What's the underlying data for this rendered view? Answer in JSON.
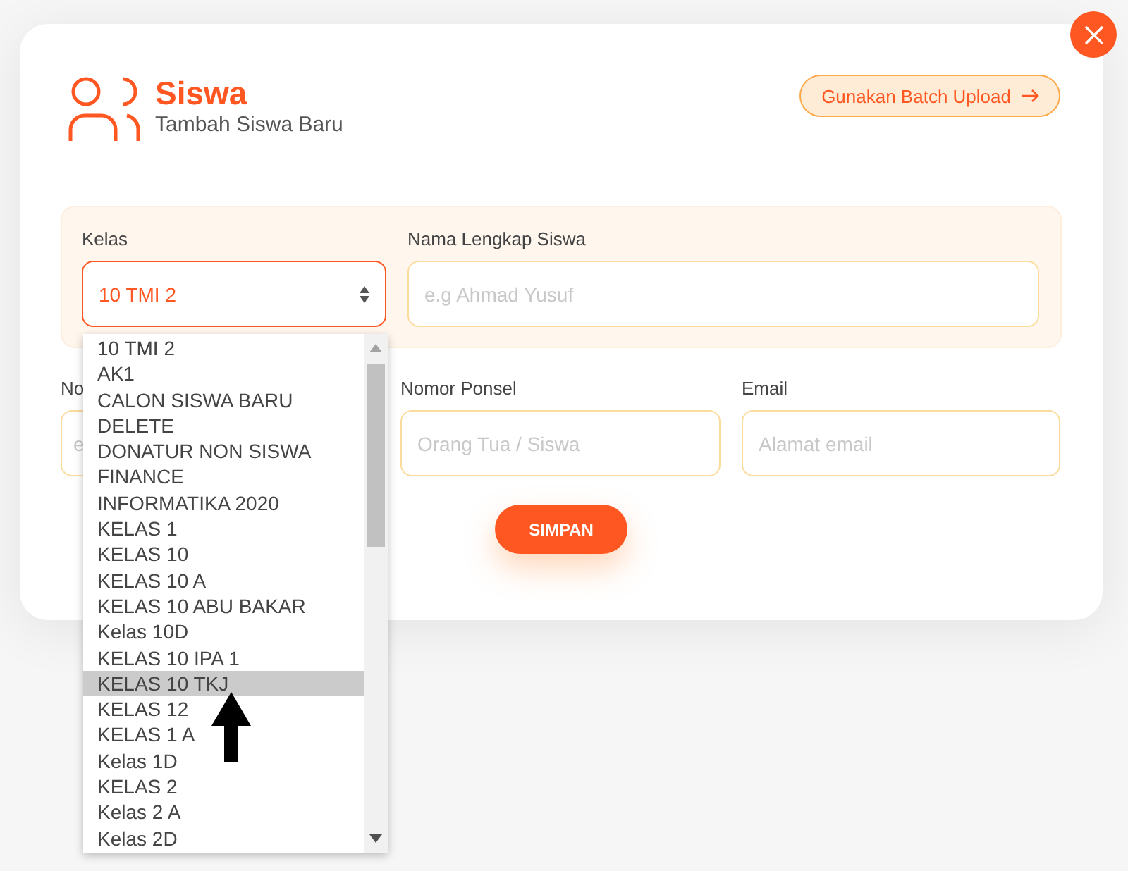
{
  "header": {
    "title": "Siswa",
    "subtitle": "Tambah Siswa Baru"
  },
  "batch_button": {
    "label": "Gunakan Batch Upload"
  },
  "form": {
    "panel_fields": [
      {
        "kind": "select",
        "label": "Kelas",
        "value": "10 TMI 2"
      },
      {
        "kind": "text",
        "label": "Nama Lengkap Siswa",
        "placeholder": "e.g Ahmad Yusuf"
      }
    ],
    "fields": [
      {
        "kind": "text",
        "label": "No",
        "placeholder": "e"
      },
      {
        "kind": "text",
        "label": "Nomor Ponsel",
        "placeholder": "Orang Tua / Siswa"
      },
      {
        "kind": "text",
        "label": "Email",
        "placeholder": "Alamat email"
      }
    ],
    "submit": "SIMPAN"
  },
  "dropdown": {
    "options": [
      {
        "label": "10 TMI 2",
        "selected": false
      },
      {
        "label": "AK1",
        "selected": false
      },
      {
        "label": "CALON SISWA BARU",
        "selected": false
      },
      {
        "label": "DELETE",
        "selected": false
      },
      {
        "label": "DONATUR NON SISWA",
        "selected": false
      },
      {
        "label": "FINANCE",
        "selected": false
      },
      {
        "label": "INFORMATIKA 2020",
        "selected": false
      },
      {
        "label": "KELAS 1",
        "selected": false
      },
      {
        "label": "KELAS 10",
        "selected": false
      },
      {
        "label": "KELAS 10 A",
        "selected": false
      },
      {
        "label": "KELAS 10 ABU BAKAR",
        "selected": false
      },
      {
        "label": "Kelas 10D",
        "selected": false
      },
      {
        "label": "KELAS 10 IPA 1",
        "selected": false
      },
      {
        "label": "KELAS 10 TKJ",
        "selected": true
      },
      {
        "label": "KELAS 12",
        "selected": false
      },
      {
        "label": "KELAS 1 A",
        "selected": false
      },
      {
        "label": "Kelas 1D",
        "selected": false
      },
      {
        "label": "KELAS 2",
        "selected": false
      },
      {
        "label": "Kelas 2 A",
        "selected": false
      },
      {
        "label": "Kelas 2D",
        "selected": false
      }
    ]
  }
}
